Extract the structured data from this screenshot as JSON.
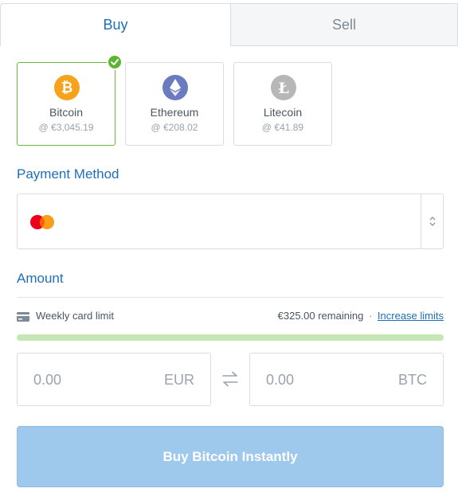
{
  "tabs": {
    "buy": "Buy",
    "sell": "Sell"
  },
  "coins": [
    {
      "name": "Bitcoin",
      "price": "@ €3,045.19",
      "icon": "bitcoin-icon",
      "color": "#f7a21b",
      "selected": true
    },
    {
      "name": "Ethereum",
      "price": "@ €208.02",
      "icon": "ethereum-icon",
      "color": "#6b7bbf",
      "selected": false
    },
    {
      "name": "Litecoin",
      "price": "@ €41.89",
      "icon": "litecoin-icon",
      "color": "#b7b7b7",
      "selected": false
    }
  ],
  "payment": {
    "title": "Payment Method",
    "selected_icon": "mastercard-icon"
  },
  "amount": {
    "title": "Amount",
    "limit_label": "Weekly card limit",
    "remaining": "€325.00 remaining",
    "separator": "·",
    "increase_link": "Increase limits",
    "limit_used_fraction": 0.0,
    "fiat_value": "0.00",
    "fiat_currency": "EUR",
    "crypto_value": "0.00",
    "crypto_currency": "BTC"
  },
  "action": {
    "buy_label": "Buy Bitcoin Instantly"
  },
  "colors": {
    "accent": "#1f6fb8",
    "selected_border": "#6bb83c",
    "check": "#5cb531",
    "progress": "#c7e6b5",
    "button": "#9ec8ec"
  }
}
